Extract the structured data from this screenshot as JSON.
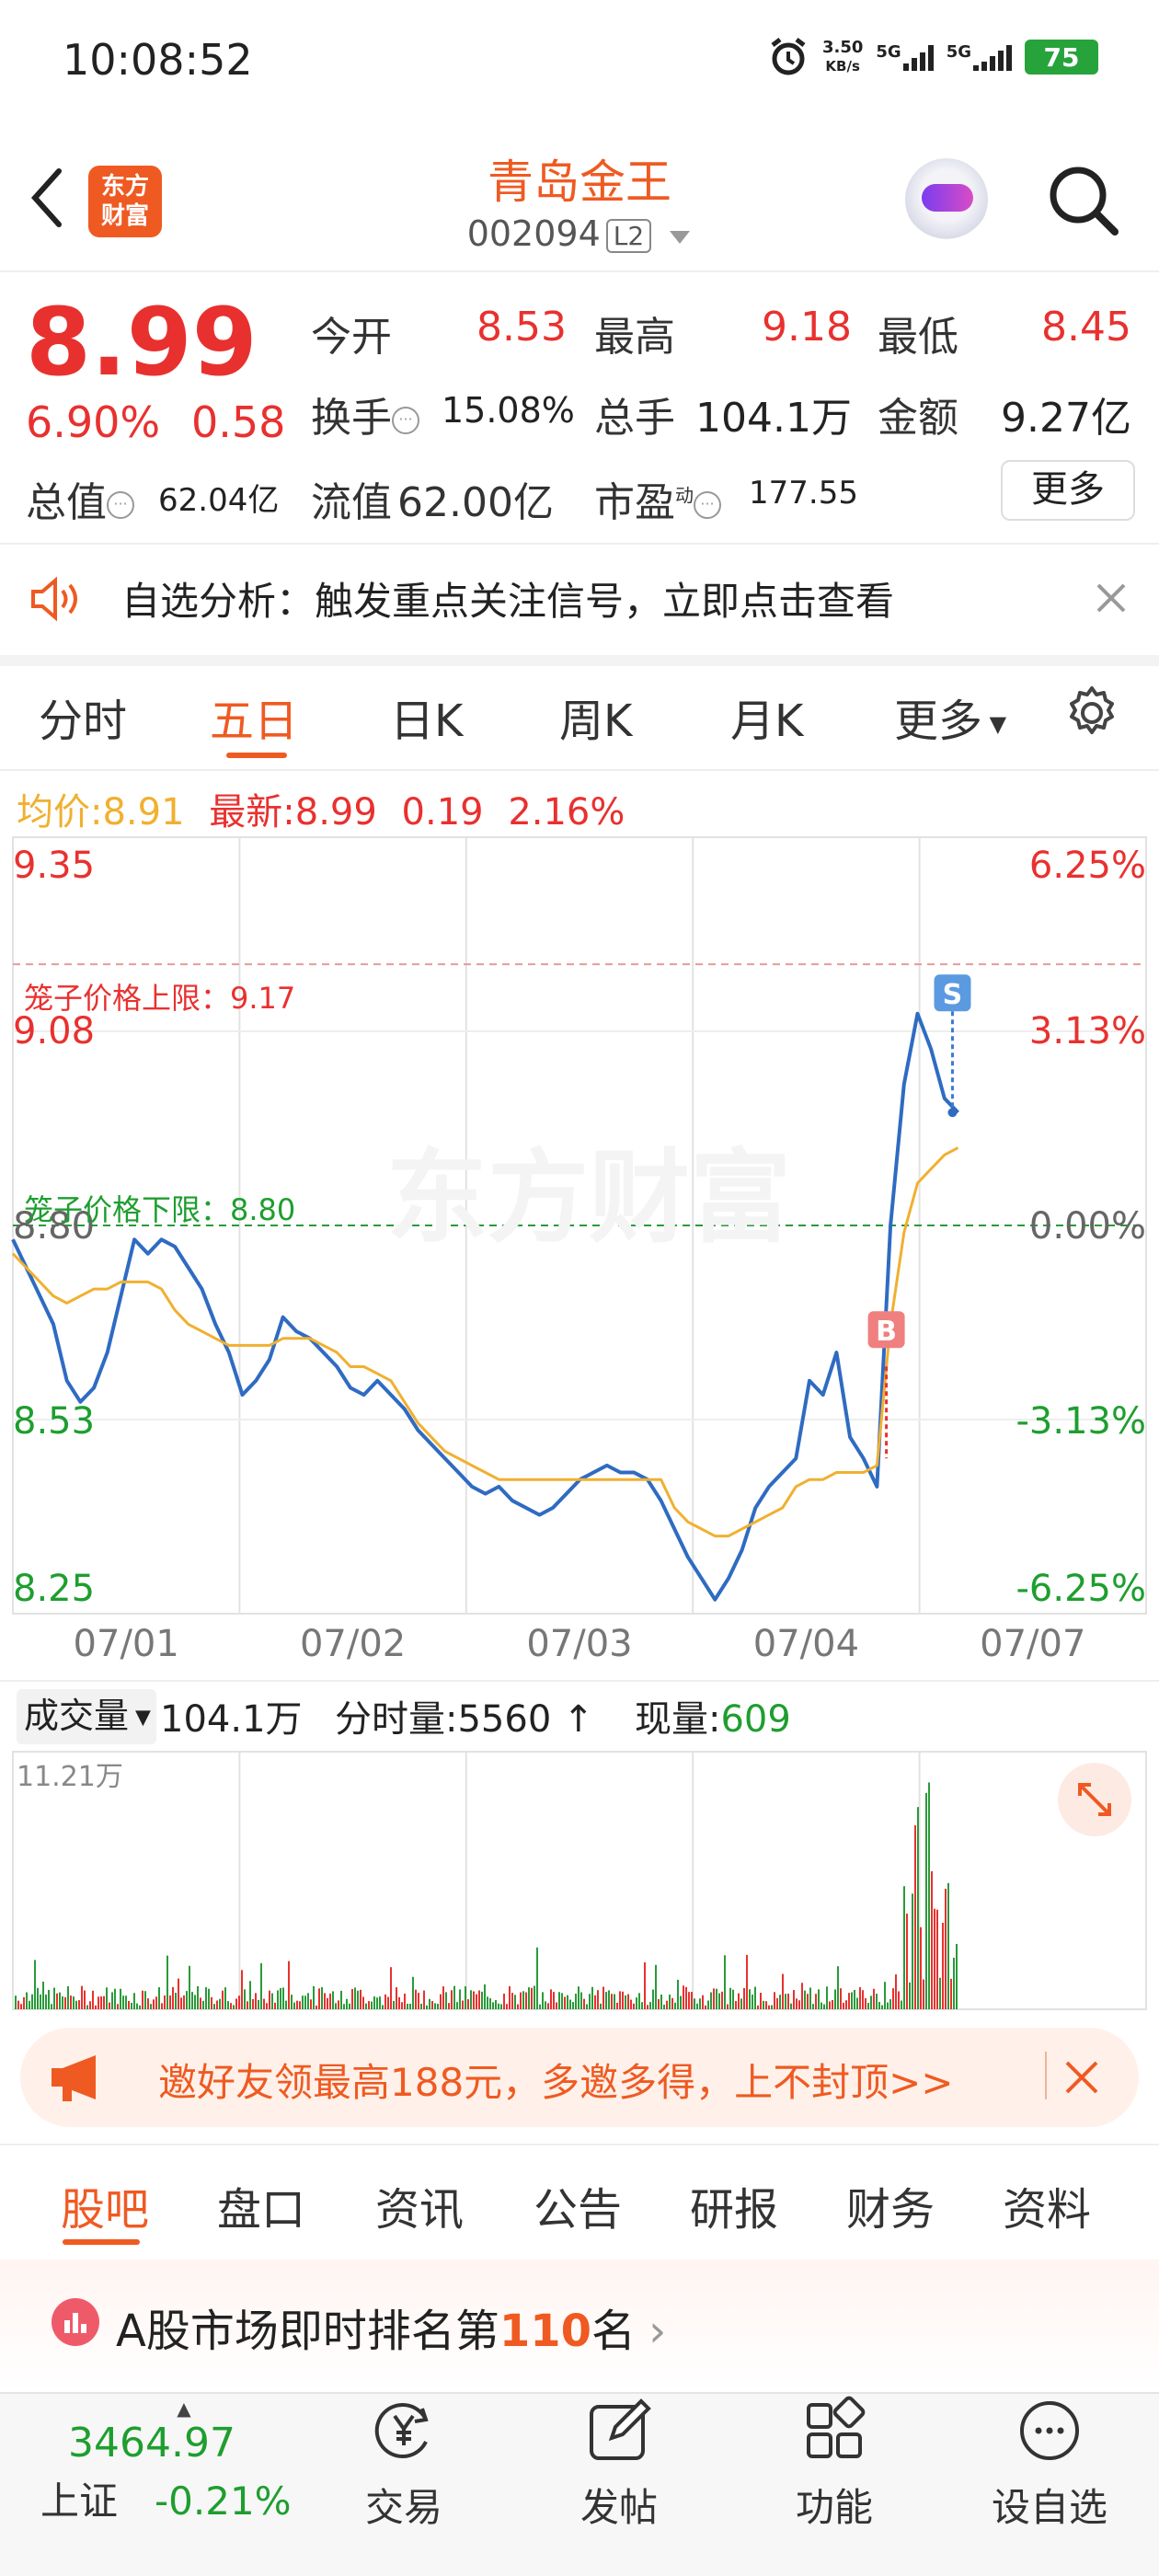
{
  "status_bar": {
    "time": "10:08:52",
    "net_speed": "3.50",
    "net_unit": "KB/s",
    "sig1": "5G",
    "sig2": "5G",
    "battery": "75"
  },
  "header": {
    "logo_line1": "东方",
    "logo_line2": "财富",
    "stock_name": "青岛金王",
    "stock_code": "002094",
    "level": "L2"
  },
  "quote": {
    "price": "8.99",
    "change_pct": "6.90%",
    "change": "0.58",
    "open_label": "今开",
    "open": "8.53",
    "high_label": "最高",
    "high": "9.18",
    "low_label": "最低",
    "low": "8.45",
    "turnover_label": "换手",
    "turnover": "15.08%",
    "volume_label": "总手",
    "volume": "104.1万",
    "amount_label": "金额",
    "amount": "9.27亿",
    "mcap_label": "总值",
    "mcap": "62.04亿",
    "float_label": "流值",
    "float_val": "62.00亿",
    "pe_label": "市盈",
    "pe_sup": "动",
    "pe": "177.55",
    "more": "更多"
  },
  "notice": {
    "text": "自选分析：触发重点关注信号，立即点击查看"
  },
  "tabs": [
    "分时",
    "五日",
    "日K",
    "周K",
    "月K",
    "更多"
  ],
  "legend": {
    "avg_label": "均价:",
    "avg": "8.91",
    "latest_label": "最新:",
    "latest": "8.99",
    "chg": "0.19",
    "pct": "2.16%"
  },
  "chart_labels": {
    "y_top": "9.35",
    "y_2": "9.08",
    "y_mid": "8.80",
    "y_4": "8.53",
    "y_bot": "8.25",
    "p_top": "6.25%",
    "p_2": "3.13%",
    "p_mid": "0.00%",
    "p_4": "-3.13%",
    "p_bot": "-6.25%",
    "upper_limit": "笼子价格上限：9.17",
    "lower_limit": "笼子价格下限：8.80",
    "watermark": "东方财富",
    "buy": "B",
    "sell": "S"
  },
  "chart_data": {
    "type": "line",
    "x_ticks": [
      "07/01",
      "07/02",
      "07/03",
      "07/04",
      "07/07"
    ],
    "ylim": [
      8.25,
      9.35
    ],
    "pct_lim": [
      "-6.25%",
      "6.25%"
    ],
    "series": [
      {
        "name": "",
        "color": "#2f6bc2",
        "values": [
          8.78,
          8.74,
          8.7,
          8.66,
          8.58,
          8.55,
          8.57,
          8.62,
          8.7,
          8.78,
          8.76,
          8.78,
          8.77,
          8.74,
          8.71,
          8.66,
          8.62,
          8.56,
          8.58,
          8.61,
          8.67,
          8.65,
          8.64,
          8.62,
          8.6,
          8.57,
          8.56,
          8.58,
          8.56,
          8.54,
          8.51,
          8.49,
          8.47,
          8.45,
          8.43,
          8.42,
          8.43,
          8.41,
          8.4,
          8.39,
          8.4,
          8.42,
          8.44,
          8.45,
          8.46,
          8.45,
          8.45,
          8.44,
          8.41,
          8.37,
          8.33,
          8.3,
          8.27,
          8.3,
          8.34,
          8.4,
          8.43,
          8.45,
          8.47,
          8.58,
          8.56,
          8.62,
          8.5,
          8.47,
          8.43,
          8.8,
          9.0,
          9.1,
          9.05,
          8.98,
          8.96
        ]
      },
      {
        "name": "",
        "color": "#f0b030",
        "values": [
          8.76,
          8.74,
          8.72,
          8.7,
          8.69,
          8.7,
          8.71,
          8.71,
          8.72,
          8.72,
          8.72,
          8.71,
          8.68,
          8.66,
          8.65,
          8.64,
          8.63,
          8.63,
          8.63,
          8.63,
          8.64,
          8.64,
          8.64,
          8.63,
          8.62,
          8.6,
          8.6,
          8.59,
          8.58,
          8.55,
          8.52,
          8.5,
          8.48,
          8.47,
          8.46,
          8.45,
          8.44,
          8.44,
          8.44,
          8.44,
          8.44,
          8.44,
          8.44,
          8.44,
          8.44,
          8.44,
          8.44,
          8.44,
          8.44,
          8.4,
          8.38,
          8.37,
          8.36,
          8.36,
          8.37,
          8.38,
          8.39,
          8.4,
          8.43,
          8.44,
          8.44,
          8.45,
          8.45,
          8.45,
          8.46,
          8.66,
          8.79,
          8.86,
          8.88,
          8.9,
          8.91
        ]
      }
    ],
    "volume_label": "成交量",
    "volume_total": "104.1万",
    "period_vol_label": "分时量:",
    "period_vol": "5560",
    "now_vol_label": "现量:",
    "now_vol": "609",
    "vol_max": "11.21万"
  },
  "promo": {
    "text": "邀好友领最高188元，多邀多得，上不封顶>>"
  },
  "bottom_tabs": [
    "股吧",
    "盘口",
    "资讯",
    "公告",
    "研报",
    "财务",
    "资料"
  ],
  "rank": {
    "prefix": "A股市场即时排名第",
    "num": "110",
    "suffix": "名"
  },
  "nav": {
    "index_value": "3464.97",
    "index_name": "上证",
    "index_change": "-0.21%",
    "trade": "交易",
    "post": "发帖",
    "func": "功能",
    "addfav": "设自选"
  }
}
